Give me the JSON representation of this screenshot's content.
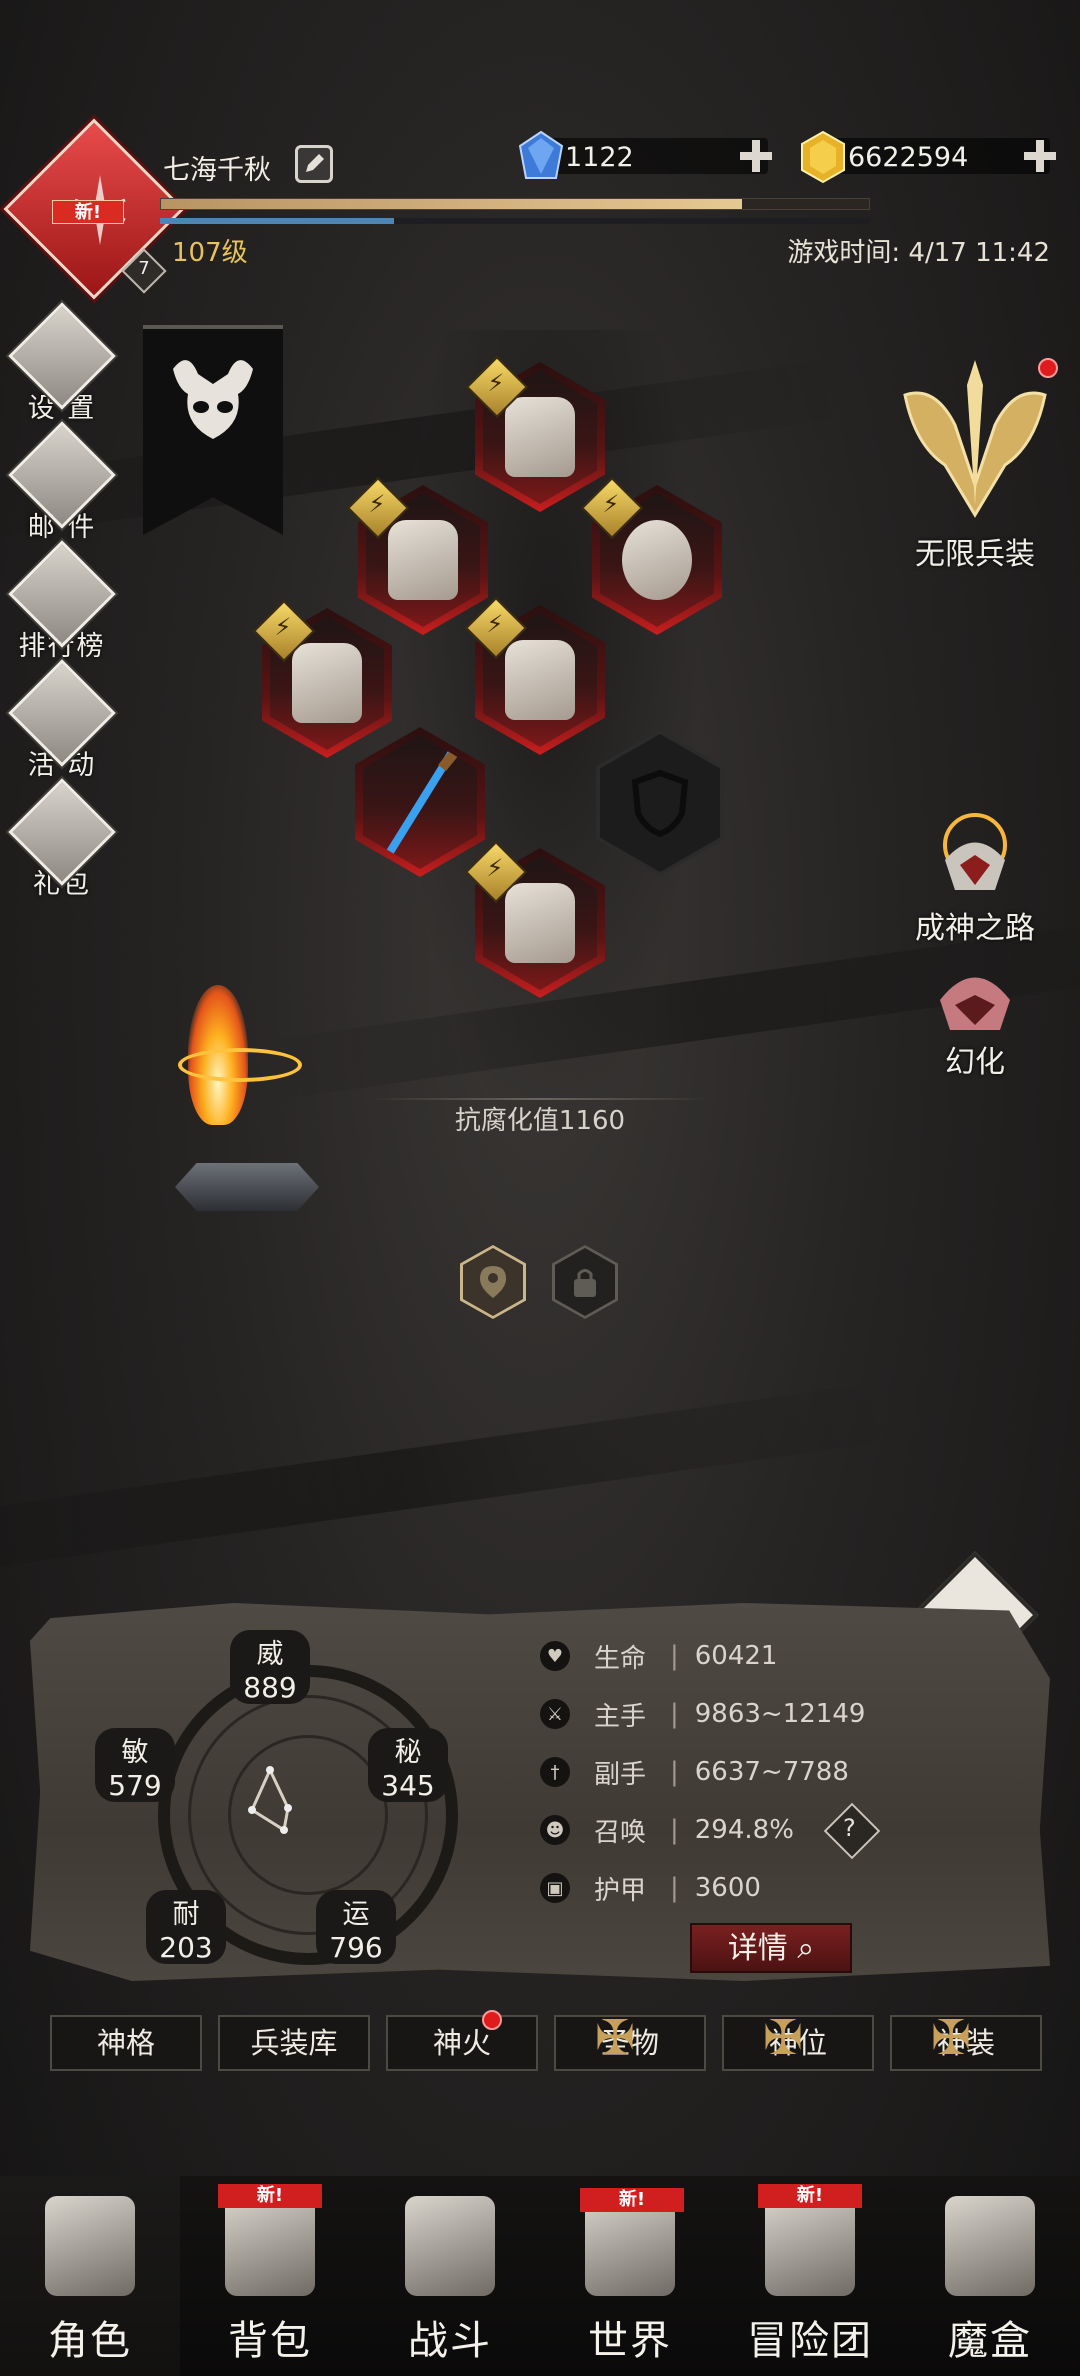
{
  "header": {
    "player_name": "七海千秋",
    "level": "107级",
    "level_badge": "7",
    "new_tag": "新!",
    "game_time": "游戏时间: 4/17 11:42",
    "xp_progress": 0.82,
    "mp_progress": 0.33
  },
  "currency": {
    "gems": "1122",
    "gold": "6622594"
  },
  "left_menu": [
    {
      "label": "设 置",
      "icon": "gear-icon"
    },
    {
      "label": "邮 件",
      "icon": "mail-icon"
    },
    {
      "label": "排行榜",
      "icon": "ranking-icon"
    },
    {
      "label": "活 动",
      "icon": "event-icon"
    },
    {
      "label": "礼包",
      "icon": "gift-icon"
    }
  ],
  "right_menu": {
    "infinite_gear": "无限兵装",
    "godhood_path": "成神之路",
    "transform": "幻化"
  },
  "corrosion": "抗腐化值1160",
  "attributes": {
    "wei": {
      "name": "威",
      "value": "889"
    },
    "min": {
      "name": "敏",
      "value": "579"
    },
    "mi": {
      "name": "秘",
      "value": "345"
    },
    "nai": {
      "name": "耐",
      "value": "203"
    },
    "yun": {
      "name": "运",
      "value": "796"
    }
  },
  "stats": [
    {
      "label": "生命",
      "value": "60421",
      "icon": "heart-icon"
    },
    {
      "label": "主手",
      "value": "9863~12149",
      "icon": "sword-icon"
    },
    {
      "label": "副手",
      "value": "6637~7788",
      "icon": "dagger-icon"
    },
    {
      "label": "召唤",
      "value": "294.8%",
      "icon": "summon-icon"
    },
    {
      "label": "护甲",
      "value": "3600",
      "icon": "armor-icon"
    }
  ],
  "help": "?",
  "stat_sep": "|",
  "detail_button": "详情",
  "sub_tabs": [
    "神格",
    "兵装库",
    "神火",
    "圣物",
    "神位",
    "神装"
  ],
  "bottom_nav": [
    {
      "label": "角色",
      "new": false
    },
    {
      "label": "背包",
      "new": true
    },
    {
      "label": "战斗",
      "new": false
    },
    {
      "label": "世界",
      "new": true
    },
    {
      "label": "冒险团",
      "new": true
    },
    {
      "label": "魔盒",
      "new": false
    }
  ],
  "nav_new_label": "新!",
  "colors": {
    "accent_red": "#c91e1e",
    "gold": "#e8c35a",
    "xp": "#e6c892",
    "mp": "#4a86b8"
  }
}
